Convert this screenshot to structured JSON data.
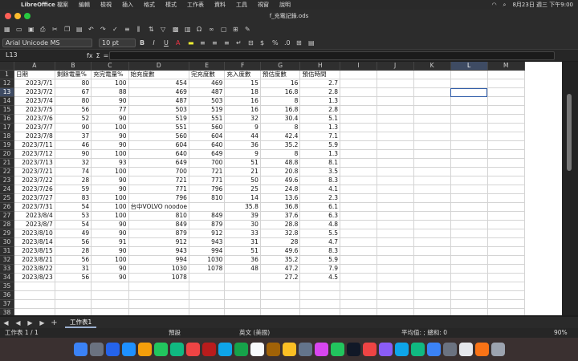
{
  "menubar": {
    "app": "LibreOffice",
    "menus": [
      "檔案",
      "編輯",
      "檢視",
      "插入",
      "格式",
      "樣式",
      "工作表",
      "資料",
      "工具",
      "視窗",
      "說明"
    ],
    "datetime": "8月23日 週三 下午9:00"
  },
  "window": {
    "title": "f_充電記錄.ods"
  },
  "toolbar": {
    "font_name": "Arial Unicode MS",
    "font_size": "10 pt"
  },
  "formula": {
    "cell_ref": "L13",
    "sigma": "Σ",
    "fx": "fx",
    "equals": "="
  },
  "sheet": {
    "columns": [
      "A",
      "B",
      "C",
      "D",
      "E",
      "F",
      "G",
      "H",
      "I",
      "J",
      "K",
      "L",
      "M"
    ],
    "header_row": {
      "num": "1",
      "cells": [
        "日期",
        "剩餘電量%",
        "充完電量%",
        "始充度數",
        "完充度數",
        "充入度數",
        "預估度數",
        "預估時間"
      ]
    },
    "rows": [
      {
        "num": "12",
        "cells": [
          "2023/7/1",
          "80",
          "100",
          "454",
          "469",
          "15",
          "16",
          "2.7"
        ]
      },
      {
        "num": "13",
        "cells": [
          "2023/7/2",
          "67",
          "88",
          "469",
          "487",
          "18",
          "16.8",
          "2.8"
        ]
      },
      {
        "num": "14",
        "cells": [
          "2023/7/4",
          "80",
          "90",
          "487",
          "503",
          "16",
          "8",
          "1.3"
        ]
      },
      {
        "num": "15",
        "cells": [
          "2023/7/5",
          "56",
          "77",
          "503",
          "519",
          "16",
          "16.8",
          "2.8"
        ]
      },
      {
        "num": "16",
        "cells": [
          "2023/7/6",
          "52",
          "90",
          "519",
          "551",
          "32",
          "30.4",
          "5.1"
        ]
      },
      {
        "num": "17",
        "cells": [
          "2023/7/7",
          "90",
          "100",
          "551",
          "560",
          "9",
          "8",
          "1.3"
        ]
      },
      {
        "num": "18",
        "cells": [
          "2023/7/8",
          "37",
          "90",
          "560",
          "604",
          "44",
          "42.4",
          "7.1"
        ]
      },
      {
        "num": "19",
        "cells": [
          "2023/7/11",
          "46",
          "90",
          "604",
          "640",
          "36",
          "35.2",
          "5.9"
        ]
      },
      {
        "num": "20",
        "cells": [
          "2023/7/12",
          "90",
          "100",
          "640",
          "649",
          "9",
          "8",
          "1.3"
        ]
      },
      {
        "num": "21",
        "cells": [
          "2023/7/13",
          "32",
          "93",
          "649",
          "700",
          "51",
          "48.8",
          "8.1"
        ]
      },
      {
        "num": "22",
        "cells": [
          "2023/7/21",
          "74",
          "100",
          "700",
          "721",
          "21",
          "20.8",
          "3.5"
        ]
      },
      {
        "num": "23",
        "cells": [
          "2023/7/22",
          "28",
          "90",
          "721",
          "771",
          "50",
          "49.6",
          "8.3"
        ]
      },
      {
        "num": "24",
        "cells": [
          "2023/7/26",
          "59",
          "90",
          "771",
          "796",
          "25",
          "24.8",
          "4.1"
        ]
      },
      {
        "num": "25",
        "cells": [
          "2023/7/27",
          "83",
          "100",
          "796",
          "810",
          "14",
          "13.6",
          "2.3"
        ]
      },
      {
        "num": "26",
        "cells": [
          "2023/7/31",
          "54",
          "100",
          "台中VOLVO noodoe",
          "",
          "35.8",
          "36.8",
          "6.1"
        ]
      },
      {
        "num": "27",
        "cells": [
          "2023/8/4",
          "53",
          "100",
          "810",
          "849",
          "39",
          "37.6",
          "6.3"
        ]
      },
      {
        "num": "28",
        "cells": [
          "2023/8/7",
          "54",
          "90",
          "849",
          "879",
          "30",
          "28.8",
          "4.8"
        ]
      },
      {
        "num": "29",
        "cells": [
          "2023/8/10",
          "49",
          "90",
          "879",
          "912",
          "33",
          "32.8",
          "5.5"
        ]
      },
      {
        "num": "30",
        "cells": [
          "2023/8/14",
          "56",
          "91",
          "912",
          "943",
          "31",
          "28",
          "4.7"
        ]
      },
      {
        "num": "31",
        "cells": [
          "2023/8/15",
          "28",
          "90",
          "943",
          "994",
          "51",
          "49.6",
          "8.3"
        ]
      },
      {
        "num": "32",
        "cells": [
          "2023/8/21",
          "56",
          "100",
          "994",
          "1030",
          "36",
          "35.2",
          "5.9"
        ]
      },
      {
        "num": "33",
        "cells": [
          "2023/8/22",
          "31",
          "90",
          "1030",
          "1078",
          "48",
          "47.2",
          "7.9"
        ]
      },
      {
        "num": "34",
        "cells": [
          "2023/8/23",
          "56",
          "90",
          "1078",
          "",
          "",
          "27.2",
          "4.5"
        ]
      }
    ],
    "empty_rows": [
      "35",
      "36",
      "37",
      "38",
      "39",
      "40"
    ]
  },
  "tabs": {
    "add": "+",
    "sheet1": "工作表1"
  },
  "statusbar": {
    "sheet_pos": "工作表 1 / 1",
    "style": "預設",
    "language": "英文 (美國)",
    "summary": "平均值: ; 總和: 0",
    "zoom": "90%"
  },
  "colors": {
    "accent": "#2d5aa8"
  }
}
